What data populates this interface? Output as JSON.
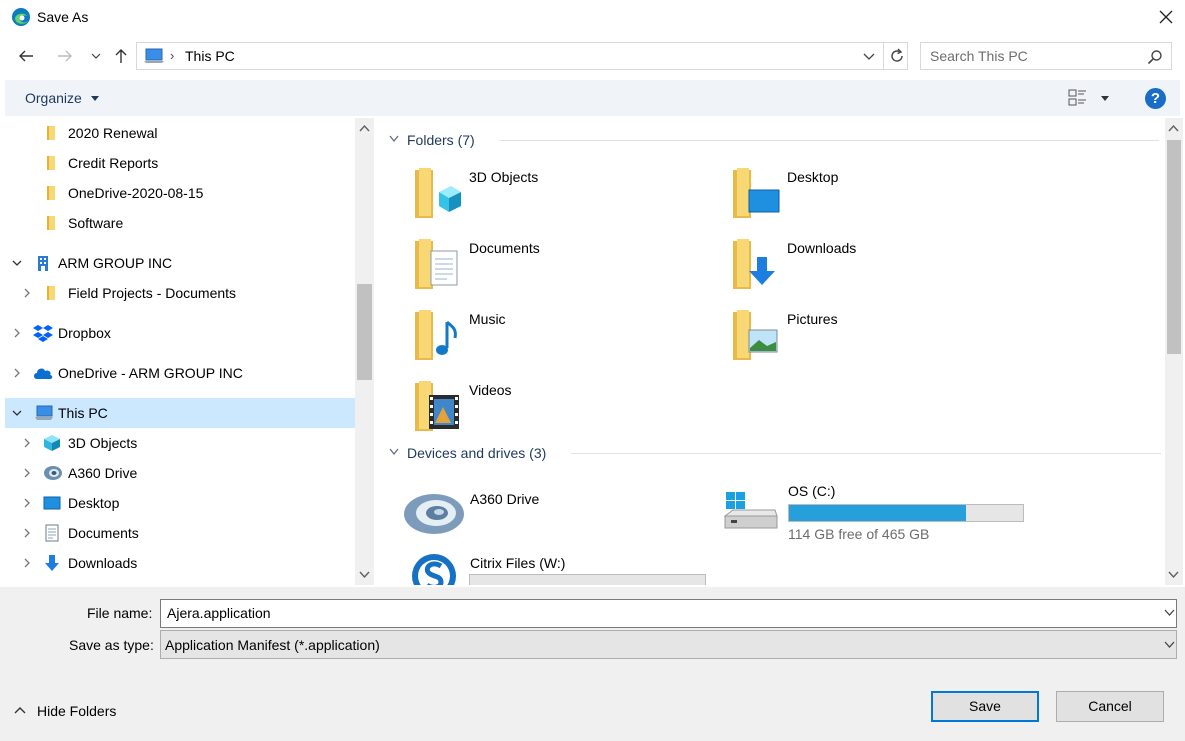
{
  "window": {
    "title": "Save As"
  },
  "address": {
    "path": "This PC",
    "search_placeholder": "Search This PC"
  },
  "toolbar": {
    "organize_label": "Organize"
  },
  "nav": {
    "items": [
      {
        "label": "2020 Renewal",
        "icon": "folder-icon"
      },
      {
        "label": "Credit Reports",
        "icon": "folder-icon"
      },
      {
        "label": "OneDrive-2020-08-15",
        "icon": "folder-icon"
      },
      {
        "label": "Software",
        "icon": "folder-icon"
      },
      {
        "label": "ARM GROUP INC",
        "icon": "building-icon"
      },
      {
        "label": "Field Projects - Documents",
        "icon": "folder-icon"
      },
      {
        "label": "Dropbox",
        "icon": "dropbox-icon"
      },
      {
        "label": "OneDrive - ARM GROUP INC",
        "icon": "cloud-icon"
      },
      {
        "label": "This PC",
        "icon": "pc-icon"
      },
      {
        "label": "3D Objects",
        "icon": "3d-objects-icon"
      },
      {
        "label": "A360 Drive",
        "icon": "a360-icon"
      },
      {
        "label": "Desktop",
        "icon": "desktop-icon"
      },
      {
        "label": "Documents",
        "icon": "documents-icon"
      },
      {
        "label": "Downloads",
        "icon": "downloads-icon"
      }
    ]
  },
  "content": {
    "folders_header": "Folders (7)",
    "folders": [
      {
        "label": "3D Objects",
        "icon": "3d-objects-folder-icon"
      },
      {
        "label": "Desktop",
        "icon": "desktop-folder-icon"
      },
      {
        "label": "Documents",
        "icon": "documents-folder-icon"
      },
      {
        "label": "Downloads",
        "icon": "downloads-folder-icon"
      },
      {
        "label": "Music",
        "icon": "music-folder-icon"
      },
      {
        "label": "Pictures",
        "icon": "pictures-folder-icon"
      },
      {
        "label": "Videos",
        "icon": "videos-folder-icon"
      }
    ],
    "drives_header": "Devices and drives (3)",
    "drives": [
      {
        "label": "A360 Drive",
        "icon": "a360-drive-icon"
      },
      {
        "label": "OS (C:)",
        "icon": "os-drive-icon",
        "free_text": "114 GB free of 465 GB",
        "used_fraction": 0.755
      },
      {
        "label": "Citrix Files (W:)",
        "icon": "citrix-icon",
        "used_fraction": 0.0
      }
    ]
  },
  "form": {
    "filename_label": "File name:",
    "filename_value": "Ajera.application",
    "type_label": "Save as type:",
    "type_value": "Application Manifest (*.application)"
  },
  "footer": {
    "hide_folders": "Hide Folders",
    "save": "Save",
    "cancel": "Cancel"
  },
  "colors": {
    "accent": "#0078d7",
    "selection": "#cce8ff",
    "drive_bar": "#26a0da",
    "folder": "#f8d775"
  }
}
